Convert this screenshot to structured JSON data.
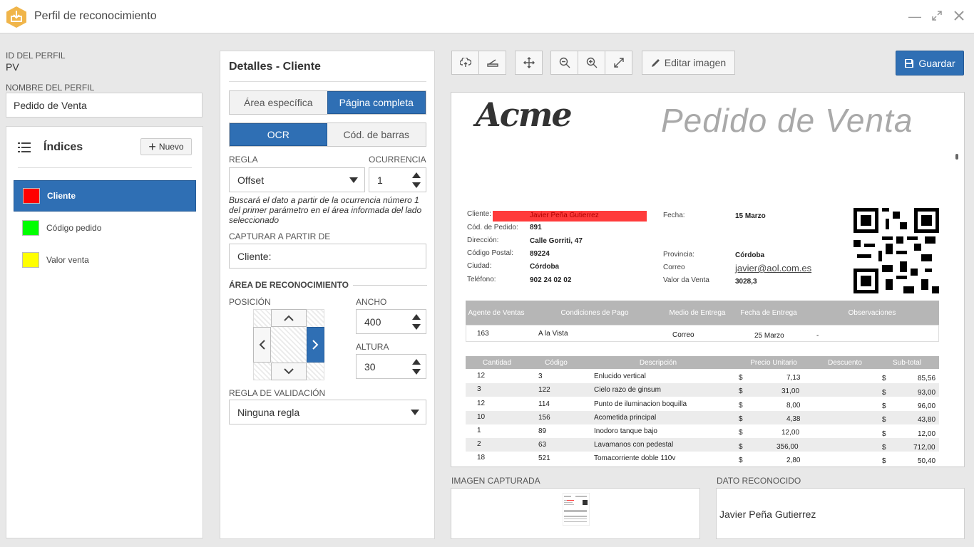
{
  "window": {
    "title": "Perfil de reconocimiento"
  },
  "profile": {
    "id_label": "ID DEL PERFIL",
    "id_value": "PV",
    "name_label": "NOMBRE DEL PERFIL",
    "name_value": "Pedido de Venta"
  },
  "indices": {
    "title": "Índices",
    "new_label": "Nuevo",
    "items": [
      {
        "label": "Cliente",
        "color": "#ff0000"
      },
      {
        "label": "Código pedido",
        "color": "#00ff00"
      },
      {
        "label": "Valor venta",
        "color": "#ffff00"
      }
    ]
  },
  "details": {
    "title": "Detalles - Cliente",
    "area_tabs": [
      "Área específica",
      "Página completa"
    ],
    "mode_tabs": [
      "OCR",
      "Cód. de barras"
    ],
    "rule_label": "REGLA",
    "rule_value": "Offset",
    "occurrence_label": "OCURRENCIA",
    "occurrence_value": "1",
    "help": "Buscará el dato a partir de la ocurrencia número 1 del primer parámetro en el área informada del lado seleccionado",
    "capture_label": "CAPTURAR A PARTIR DE",
    "capture_value": "Cliente:",
    "area_section": "ÁREA DE RECONOCIMIENTO",
    "position_label": "POSICIÓN",
    "width_label": "ANCHO",
    "width_value": "400",
    "height_label": "ALTURA",
    "height_value": "30",
    "validation_label": "REGLA DE VALIDACIÓN",
    "validation_value": "Ninguna regla"
  },
  "toolbar": {
    "edit_label": "Editar imagen",
    "save_label": "Guardar"
  },
  "document": {
    "logo": "Acme",
    "title": "Pedido de Venta",
    "fields_left": [
      {
        "label": "Cliente:",
        "value": "Javier Peña Gutierrez"
      },
      {
        "label": "Cód. de Pedido:",
        "value": "891"
      },
      {
        "label": "Dirección:",
        "value": "Calle Gorriti, 47"
      },
      {
        "label": "Código Postal:",
        "value": "89224"
      },
      {
        "label": "Ciudad:",
        "value": "Córdoba"
      },
      {
        "label": "Teléfono:",
        "value": "902 24 02 02"
      }
    ],
    "fields_right": [
      {
        "label": "Fecha:",
        "value": "15 Marzo"
      },
      {
        "label": "Provincia:",
        "value": "Córdoba"
      },
      {
        "label": "Correo",
        "value": "javier@aol.com.es"
      },
      {
        "label": "Valor da Venta",
        "value": "3028,3"
      }
    ],
    "table1_headers": [
      "Agente de Ventas",
      "Condiciones de Pago",
      "Medio de Entrega",
      "Fecha de Entrega",
      "Observaciones"
    ],
    "table1_row": [
      "163",
      "A la Vista",
      "Correo",
      "25 Marzo",
      "-"
    ],
    "table2_headers": [
      "Cantidad",
      "Código",
      "Descripción",
      "Precio Unitario",
      "Descuento",
      "Sub-total"
    ],
    "table2_rows": [
      [
        "12",
        "3",
        "Enlucido vertical",
        "$",
        "7,13",
        "$",
        "85,56"
      ],
      [
        "3",
        "122",
        "Cielo razo de ginsum",
        "$",
        "31,00",
        "$",
        "93,00"
      ],
      [
        "12",
        "114",
        "Punto de iluminacion boquilla",
        "$",
        "8,00",
        "$",
        "96,00"
      ],
      [
        "10",
        "156",
        "Acometida principal",
        "$",
        "4,38",
        "$",
        "43,80"
      ],
      [
        "1",
        "89",
        "Inodoro tanque bajo",
        "$",
        "12,00",
        "$",
        "12,00"
      ],
      [
        "2",
        "63",
        "Lavamanos con pedestal",
        "$",
        "356,00",
        "$",
        "712,00"
      ],
      [
        "18",
        "521",
        "Tomacorriente doble 110v",
        "$",
        "2,80",
        "$",
        "50,40"
      ]
    ]
  },
  "bottom": {
    "captured_label": "IMAGEN CAPTURADA",
    "recognized_label": "DATO RECONOCIDO",
    "recognized_value": "Javier Peña Gutierrez"
  }
}
